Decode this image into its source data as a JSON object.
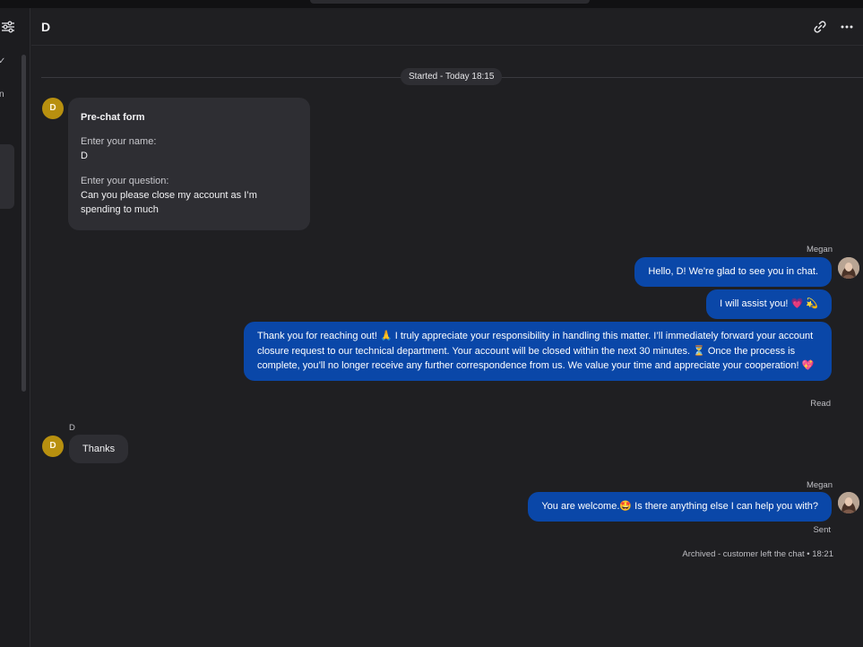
{
  "header": {
    "title": "D",
    "link_icon": "link-icon",
    "more_icon": "more-horizontal-icon"
  },
  "left_panel": {
    "filter_icon": "sliders-icon",
    "chevron": "✓",
    "letter": "n"
  },
  "timeline": {
    "started": "Started - Today 18:15"
  },
  "prechat": {
    "avatar": "D",
    "title": "Pre-chat form",
    "name_label": "Enter your name:",
    "name_value": "D",
    "question_label": "Enter your question:",
    "question_value": "Can you please close my account as I’m spending to much"
  },
  "agent_group1": {
    "name": "Megan",
    "messages": [
      "Hello, D! We're glad to see you in chat.",
      "I will assist you! 💗 💫",
      "Thank you for reaching out! 🙏 I truly appreciate your responsibility in handling this matter. I’ll immediately forward your account closure request to our technical department. Your account will be closed within the next 30 minutes. ⏳ Once the process is complete, you’ll no longer receive any further correspondence from us. We value your time and appreciate your cooperation! 💖"
    ],
    "status": "Read"
  },
  "customer_group": {
    "name": "D",
    "avatar": "D",
    "message": "Thanks"
  },
  "agent_group2": {
    "name": "Megan",
    "message": "You are welcome.🤩 Is there anything else I can help you with?",
    "status": "Sent"
  },
  "footer_status": "Archived - customer left the chat • 18:21",
  "colors": {
    "agent_bubble": "#0a47a8",
    "customer_bubble": "#2e2e33",
    "avatar_d": "#b8900f",
    "background": "#1f1f22"
  }
}
